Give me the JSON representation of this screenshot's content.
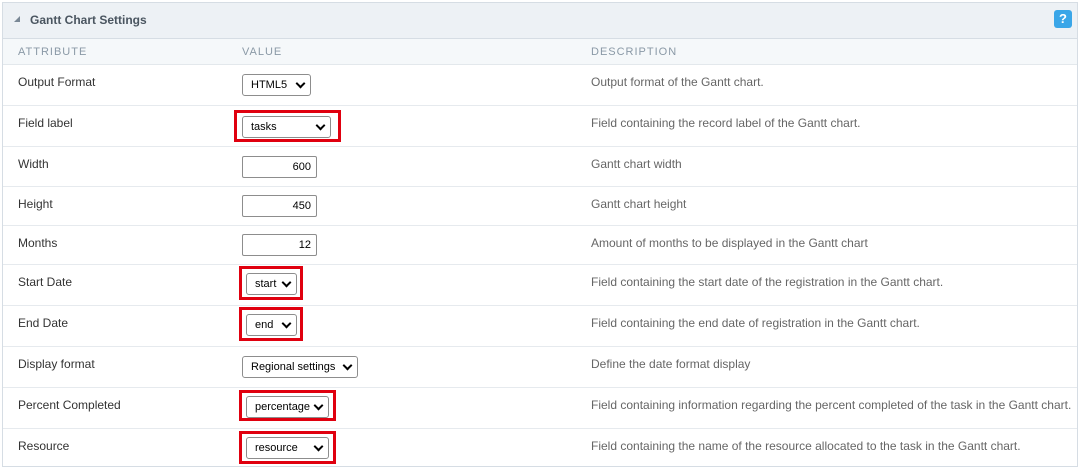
{
  "panel": {
    "title": "Gantt Chart Settings",
    "help_label": "?"
  },
  "columns": {
    "attribute": "ATTRIBUTE",
    "value": "VALUE",
    "description": "DESCRIPTION"
  },
  "rows": [
    {
      "attribute": "Output Format",
      "value": "HTML5",
      "control": "select",
      "description": "Output format of the Gantt chart."
    },
    {
      "attribute": "Field label",
      "value": "tasks",
      "control": "select",
      "description": "Field containing the record label of the Gantt chart."
    },
    {
      "attribute": "Width",
      "value": "600",
      "control": "input",
      "description": "Gantt chart width"
    },
    {
      "attribute": "Height",
      "value": "450",
      "control": "input",
      "description": "Gantt chart height"
    },
    {
      "attribute": "Months",
      "value": "12",
      "control": "input",
      "description": "Amount of months to be displayed in the Gantt chart"
    },
    {
      "attribute": "Start Date",
      "value": "start",
      "control": "select",
      "description": "Field containing the start date of the registration in the Gantt chart."
    },
    {
      "attribute": "End Date",
      "value": "end",
      "control": "select",
      "description": "Field containing the end date of registration in the Gantt chart."
    },
    {
      "attribute": "Display format",
      "value": "Regional settings",
      "control": "select",
      "description": "Define the date format display"
    },
    {
      "attribute": "Percent Completed",
      "value": "percentage",
      "control": "select",
      "description": "Field containing information regarding the percent completed of the task in the Gantt chart."
    },
    {
      "attribute": "Resource",
      "value": "resource",
      "control": "select",
      "description": "Field containing the name of the resource allocated to the task in the Gantt chart."
    }
  ],
  "colors": {
    "highlight": "#e0000f",
    "help": "#3aa6e8",
    "header_bg": "#edf1f5"
  }
}
